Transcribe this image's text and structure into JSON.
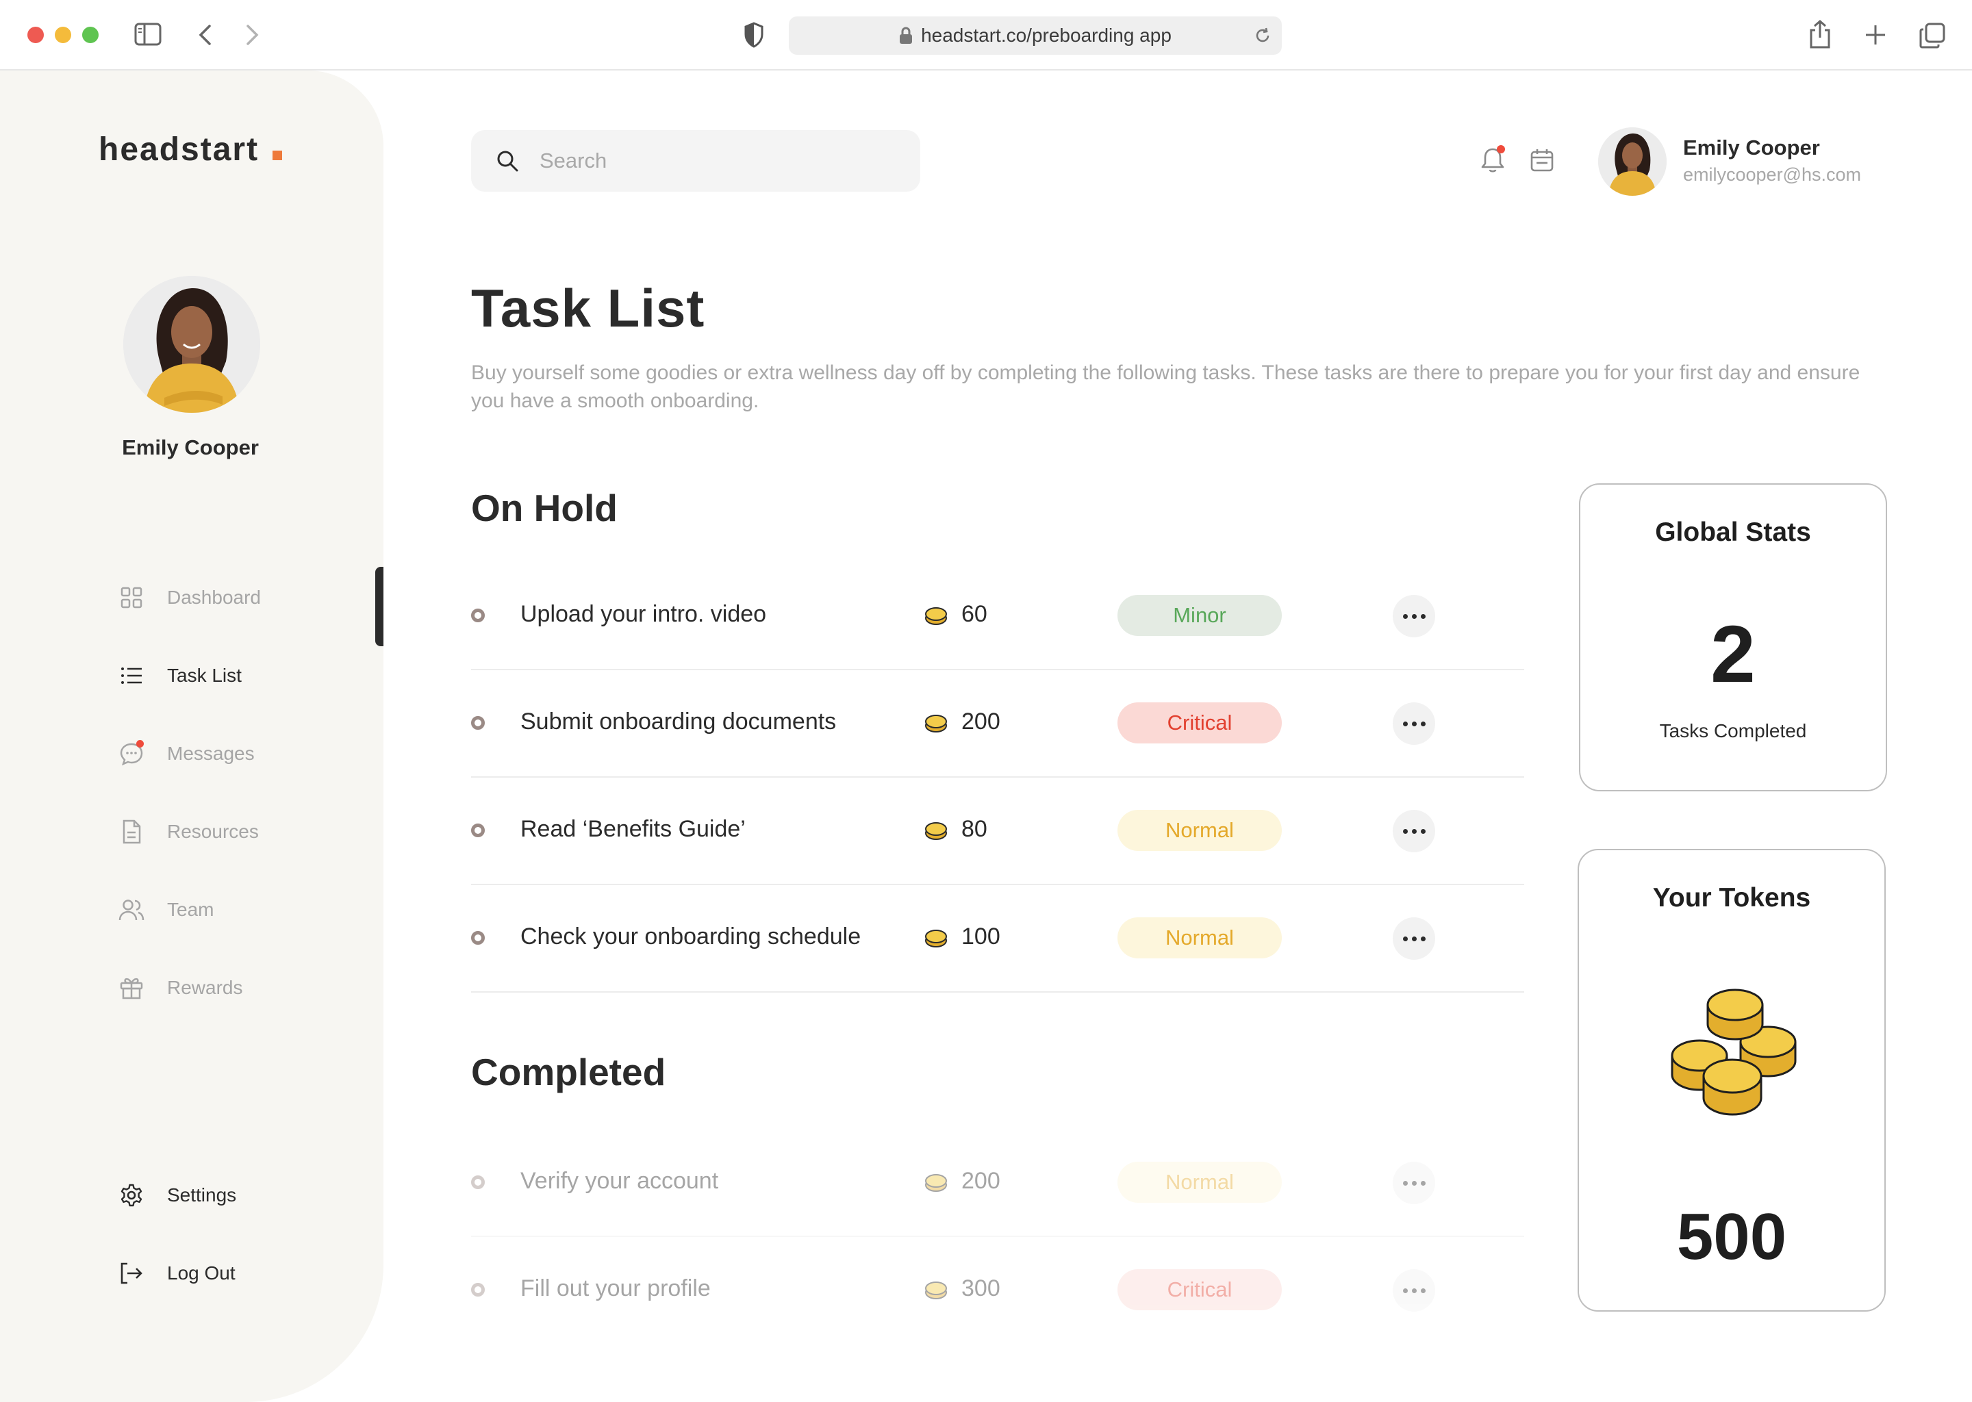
{
  "browser": {
    "url": "headstart.co/preboarding app"
  },
  "brand": {
    "name": "headstart",
    "accent": "#ee7a3b"
  },
  "sidebar": {
    "user_name": "Emily Cooper",
    "items": [
      {
        "label": "Dashboard",
        "icon": "grid-icon",
        "active": false
      },
      {
        "label": "Task List",
        "icon": "list-icon",
        "active": true
      },
      {
        "label": "Messages",
        "icon": "chat-icon",
        "active": false
      },
      {
        "label": "Resources",
        "icon": "document-icon",
        "active": false
      },
      {
        "label": "Team",
        "icon": "users-icon",
        "active": false
      },
      {
        "label": "Rewards",
        "icon": "gift-icon",
        "active": false
      }
    ],
    "bottom": [
      {
        "label": "Settings",
        "icon": "gear-icon"
      },
      {
        "label": "Log Out",
        "icon": "logout-icon"
      }
    ]
  },
  "header": {
    "search_placeholder": "Search",
    "user_name": "Emily Cooper",
    "user_email": "emilycooper@hs.com"
  },
  "main": {
    "title": "Task List",
    "description": "Buy yourself some goodies or extra wellness day off by completing the following tasks. These tasks are there to prepare you for your first day and ensure you have a smooth onboarding.",
    "on_hold": {
      "title": "On Hold",
      "tasks": [
        {
          "name": "Upload your intro. video",
          "tokens": "60",
          "priority": "Minor"
        },
        {
          "name": "Submit onboarding documents",
          "tokens": "200",
          "priority": "Critical"
        },
        {
          "name": "Read ‘Benefits Guide’",
          "tokens": "80",
          "priority": "Normal"
        },
        {
          "name": "Check your onboarding schedule",
          "tokens": "100",
          "priority": "Normal"
        }
      ]
    },
    "completed": {
      "title": "Completed",
      "tasks": [
        {
          "name": "Verify your account",
          "tokens": "200",
          "priority": "Normal"
        },
        {
          "name": "Fill out your profile",
          "tokens": "300",
          "priority": "Critical"
        }
      ]
    }
  },
  "stats": {
    "global": {
      "title": "Global Stats",
      "value": "2",
      "caption": "Tasks Completed"
    },
    "tokens": {
      "title": "Your Tokens",
      "value": "500",
      "icon": "coins-icon"
    }
  },
  "colors": {
    "minor_bg": "#e4ebe3",
    "minor_text": "#59a85a",
    "critical_bg": "#fbd9d5",
    "critical_text": "#e2402f",
    "normal_bg": "#fdf6dc",
    "normal_text": "#e4a92b",
    "coin": "#f3cc4a"
  }
}
